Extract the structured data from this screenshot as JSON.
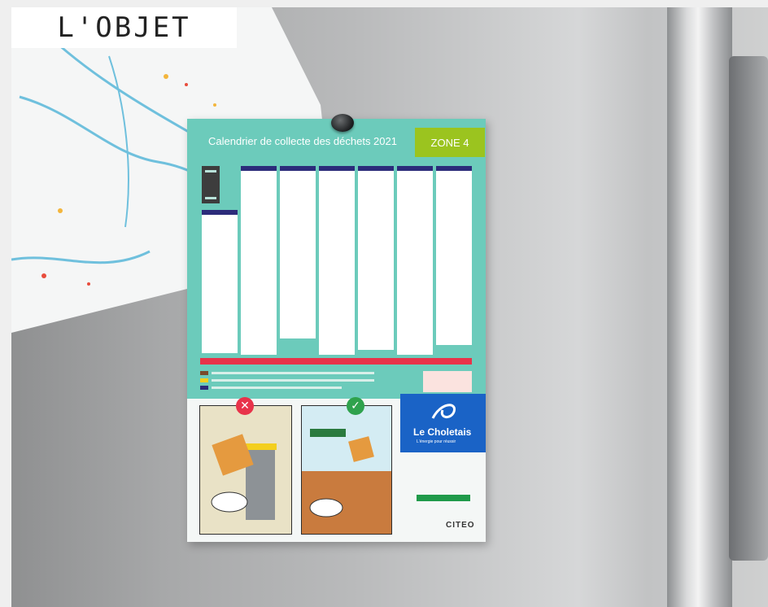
{
  "label": {
    "text": "L'OBJET"
  },
  "flyer": {
    "title": "Calendrier de collecte des déchets 2021",
    "zone": "ZONE 4",
    "brand_name": "Le Choletais",
    "brand_tagline": "L'énergie pour réussir",
    "partner": "CITEO"
  },
  "colors": {
    "teal": "#6ccbbb",
    "zone_green": "#9bc41f",
    "brand_blue": "#1a63c6",
    "notice_red": "#e8334a"
  }
}
